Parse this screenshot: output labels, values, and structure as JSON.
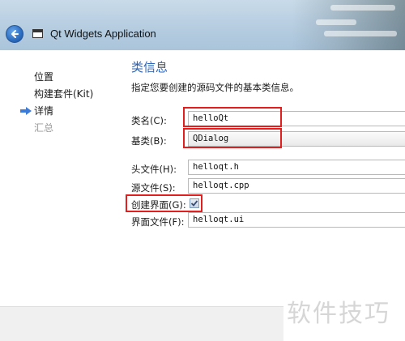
{
  "window": {
    "title": "Qt Widgets Application"
  },
  "sidebar": {
    "steps": [
      {
        "label": "位置",
        "state": "done"
      },
      {
        "label": "构建套件(Kit)",
        "state": "done"
      },
      {
        "label": "详情",
        "state": "current"
      },
      {
        "label": "汇总",
        "state": "pending"
      }
    ]
  },
  "page": {
    "title": "类信息",
    "description": "指定您要创建的源码文件的基本类信息。"
  },
  "form": {
    "class_name": {
      "label": "类名(C):",
      "value": "helloQt"
    },
    "base_class": {
      "label": "基类(B):",
      "value": "QDialog"
    },
    "header_file": {
      "label": "头文件(H):",
      "value": "helloqt.h"
    },
    "source_file": {
      "label": "源文件(S):",
      "value": "helloqt.cpp"
    },
    "generate_form": {
      "label": "创建界面(G):",
      "checked": true
    },
    "form_file": {
      "label": "界面文件(F):",
      "value": "helloqt.ui"
    }
  },
  "watermark": "软件技巧",
  "colors": {
    "accent": "#2e63b6",
    "highlight": "#e21f1f"
  }
}
